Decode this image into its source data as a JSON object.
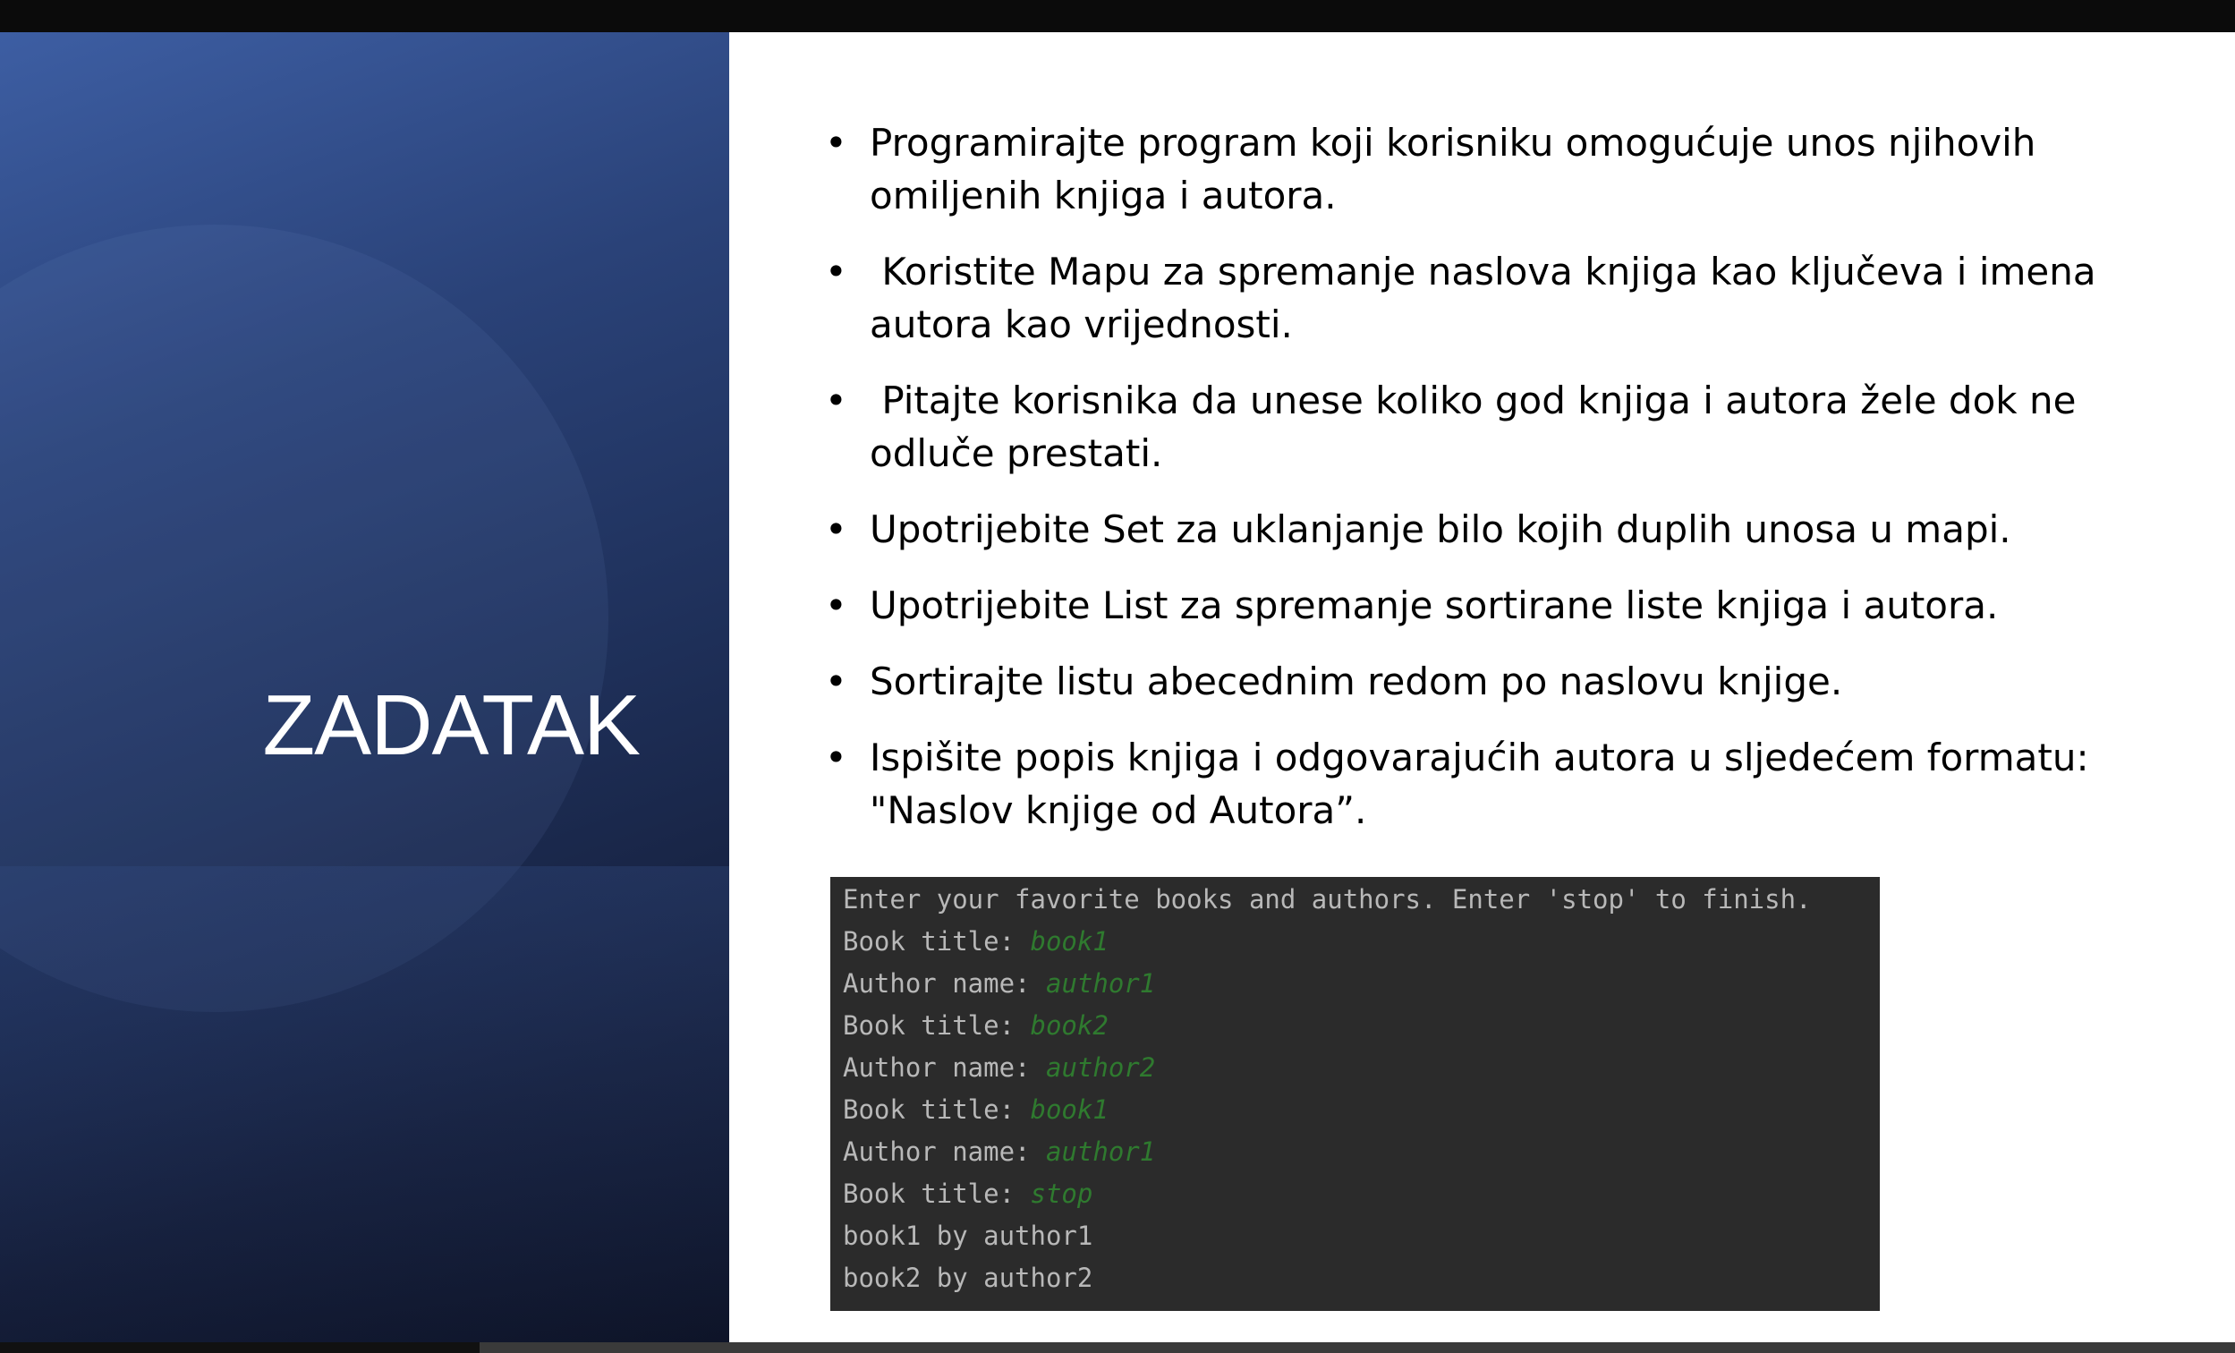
{
  "slide": {
    "title": "ZADATAK",
    "bullets": [
      {
        "line1": "Programirajte program koji korisniku omogućuje unos njihovih",
        "line2": "omiljenih knjiga i autora."
      },
      {
        "line1": " Koristite Mapu za spremanje naslova knjiga kao ključeva i imena",
        "line2": "autora kao vrijednosti."
      },
      {
        "line1": " Pitajte korisnika da unese koliko god knjiga i autora žele dok ne",
        "line2": "odluče prestati."
      },
      {
        "line1": "Upotrijebite Set za uklanjanje bilo kojih duplih unosa u mapi.",
        "line2": ""
      },
      {
        "line1": "Upotrijebite List za spremanje sortirane liste knjiga i autora.",
        "line2": ""
      },
      {
        "line1": "Sortirajte listu abecednim redom po naslovu knjige.",
        "line2": ""
      },
      {
        "line1": "Ispišite popis knjiga i odgovarajućih autora u sljedećem formatu:",
        "line2": "\"Naslov knjige od Autora”."
      }
    ],
    "bullet_symbol": "•"
  },
  "terminal": {
    "lines": [
      {
        "prompt": "Enter your favorite books and authors. Enter 'stop' to finish.",
        "input": ""
      },
      {
        "prompt": "Book title: ",
        "input": "book1"
      },
      {
        "prompt": "Author name: ",
        "input": "author1"
      },
      {
        "prompt": "Book title: ",
        "input": "book2"
      },
      {
        "prompt": "Author name: ",
        "input": "author2"
      },
      {
        "prompt": "Book title: ",
        "input": "book1"
      },
      {
        "prompt": "Author name: ",
        "input": "author1"
      },
      {
        "prompt": "Book title: ",
        "input": "stop"
      },
      {
        "prompt": "book1 by author1",
        "input": ""
      },
      {
        "prompt": "book2 by author2",
        "input": ""
      }
    ]
  },
  "colors": {
    "panel_blue": "#2a4278",
    "terminal_bg": "#2b2b2b",
    "terminal_text": "#b8b8b8",
    "terminal_input": "#2f7a2f"
  }
}
